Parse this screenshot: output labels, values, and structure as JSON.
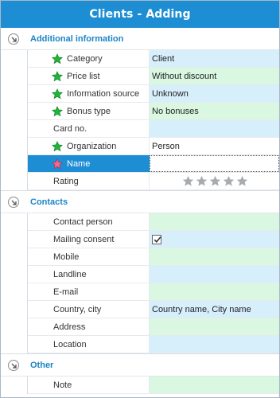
{
  "window": {
    "title": "Clients - Adding"
  },
  "groups": [
    {
      "title": "Additional information",
      "rows": [
        {
          "label": "Category",
          "value": "Client",
          "required": true,
          "bg": "blue"
        },
        {
          "label": "Price list",
          "value": "Without discount",
          "required": true,
          "bg": "green"
        },
        {
          "label": "Information source",
          "value": "Unknown",
          "required": true,
          "bg": "blue"
        },
        {
          "label": "Bonus type",
          "value": "No bonuses",
          "required": true,
          "bg": "green"
        },
        {
          "label": "Card no.",
          "value": "",
          "required": false,
          "bg": "blue"
        },
        {
          "label": "Organization",
          "value": "Person",
          "required": true,
          "bg": "white"
        },
        {
          "label": "Name",
          "value": "",
          "required": true,
          "bg": "white",
          "selected": true
        },
        {
          "label": "Rating",
          "value": "",
          "rating": 0,
          "rating_max": 5,
          "bg": "white"
        }
      ]
    },
    {
      "title": "Contacts",
      "rows": [
        {
          "label": "Contact person",
          "value": "",
          "bg": "green"
        },
        {
          "label": "Mailing consent",
          "value": "",
          "checkbox": true,
          "checked": true,
          "bg": "blue"
        },
        {
          "label": "Mobile",
          "value": "",
          "bg": "green"
        },
        {
          "label": "Landline",
          "value": "",
          "bg": "blue"
        },
        {
          "label": "E-mail",
          "value": "",
          "bg": "green"
        },
        {
          "label": "Country, city",
          "value": "Country name, City name",
          "bg": "blue"
        },
        {
          "label": "Address",
          "value": "",
          "bg": "green"
        },
        {
          "label": "Location",
          "value": "",
          "bg": "blue"
        }
      ]
    },
    {
      "title": "Other",
      "rows": [
        {
          "label": "Note",
          "value": "",
          "bg": "green"
        }
      ]
    }
  ],
  "colors": {
    "accent": "#1e8ed4",
    "group_title": "#1b84c6",
    "value_blue": "#d7eefb",
    "value_green": "#d9f7e1",
    "star_required": "#1fb53a",
    "star_required_selected": "#f06a8a",
    "rating_star": "#a9acaf"
  },
  "icons": {
    "group_toggle": "collapse-arrow-icon",
    "required": "green-star-icon",
    "required_selected": "pink-star-icon",
    "rating": "grey-star-icon",
    "check": "checkmark-icon"
  }
}
